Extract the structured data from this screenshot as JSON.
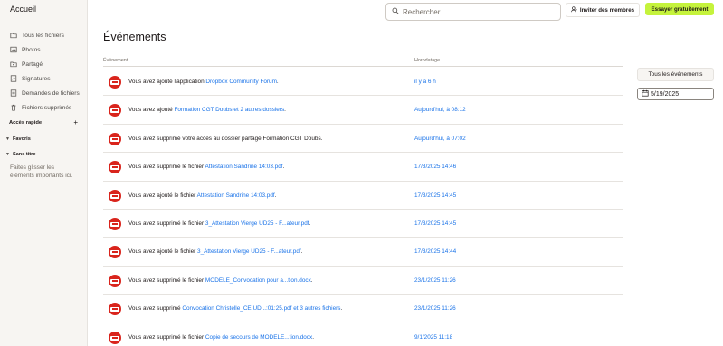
{
  "sidebar": {
    "home": "Accueil",
    "items": [
      {
        "label": "Tous les fichiers",
        "icon": "folder-icon"
      },
      {
        "label": "Photos",
        "icon": "photos-icon"
      },
      {
        "label": "Partagé",
        "icon": "shared-folder-icon"
      },
      {
        "label": "Signatures",
        "icon": "signature-icon"
      },
      {
        "label": "Demandes de fichiers",
        "icon": "file-request-icon"
      },
      {
        "label": "Fichiers supprimés",
        "icon": "trash-icon"
      }
    ],
    "quick_access": "Accès rapide",
    "quick_access_add": "+",
    "favorites": "Favoris",
    "untitled": "Sans titre",
    "drop_hint": "Faites glisser les éléments importants ici."
  },
  "topbar": {
    "search_placeholder": "Rechercher",
    "invite_label": "Inviter des membres",
    "try_label": "Essayer gratuitement"
  },
  "main": {
    "title": "Événements",
    "columns": {
      "event": "Événement",
      "timestamp": "Horodatage"
    },
    "events": [
      {
        "before": "Vous avez ajouté l'application ",
        "link": "Dropbox Community Forum",
        "after": ".",
        "time": "il y a 6 h"
      },
      {
        "before": "Vous avez ajouté ",
        "link": "Formation CGT Doubs et 2 autres dossiers",
        "after": ".",
        "time": "Aujourd'hui, à 08:12"
      },
      {
        "before": "Vous avez supprimé votre accès au dossier partagé Formation CGT Doubs.",
        "link": "",
        "after": "",
        "time": "Aujourd'hui, à 07:02"
      },
      {
        "before": "Vous avez supprimé le fichier ",
        "link": "Attestation Sandrine 14:03.pdf",
        "after": ".",
        "time": "17/3/2025 14:46"
      },
      {
        "before": "Vous avez ajouté le fichier ",
        "link": "Attestation Sandrine 14:03.pdf",
        "after": ".",
        "time": "17/3/2025 14:45"
      },
      {
        "before": "Vous avez supprimé le fichier ",
        "link": "3_Attestation Vierge UD25 - F...ateur.pdf",
        "after": ".",
        "time": "17/3/2025 14:45"
      },
      {
        "before": "Vous avez ajouté le fichier ",
        "link": "3_Attestation Vierge UD25 - F...ateur.pdf",
        "after": ".",
        "time": "17/3/2025 14:44"
      },
      {
        "before": "Vous avez supprimé le fichier ",
        "link": "MODELE_Convocation pour a...tion.docx",
        "after": ".",
        "time": "23/1/2025 11:26"
      },
      {
        "before": "Vous avez supprimé ",
        "link": "Convocation Christelle_CE UD...:01:25.pdf et 3 autres fichiers",
        "after": ".",
        "time": "23/1/2025 11:26"
      },
      {
        "before": "Vous avez supprimé le fichier ",
        "link": "Copie de secours de MODELE...tion.docx",
        "after": ".",
        "time": "9/1/2025 11:18"
      }
    ]
  },
  "filters": {
    "event_type": "Tous les événements",
    "date": "5/19/2025"
  },
  "colors": {
    "accent": "#c5f33c",
    "link": "#1a73e8",
    "avatar": "#d9241c"
  }
}
